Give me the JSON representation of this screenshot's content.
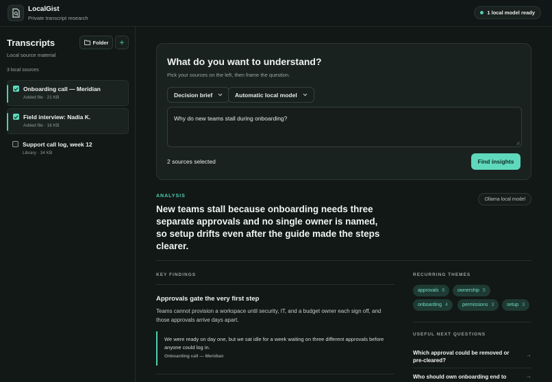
{
  "app": {
    "name": "LocalGist",
    "tagline": "Private transcript research"
  },
  "status": {
    "label": "1 local model ready",
    "color": "#4fd1b0"
  },
  "sidebar": {
    "title": "Transcripts",
    "subtitle": "Local source material",
    "folder_button": "Folder",
    "add_button": "+",
    "count": "3 local sources",
    "sources": [
      {
        "name": "Onboarding call — Meridian",
        "meta": "Added file · 21 KB",
        "checked": true
      },
      {
        "name": "Field interview: Nadia K.",
        "meta": "Added file · 16 KB",
        "checked": true
      },
      {
        "name": "Support call log, week 12",
        "meta": "Library · 34 KB",
        "checked": false
      }
    ]
  },
  "ask": {
    "title": "What do you want to understand?",
    "subtitle": "Pick your sources on the left, then frame the question.",
    "mode_select": "Decision brief",
    "model_select": "Automatic local model",
    "question": "Why do new teams stall during onboarding?",
    "selected_count": "2 sources selected",
    "submit": "Find insights"
  },
  "analysis": {
    "label": "ANALYSIS",
    "model_tag": "Ollama local model",
    "headline": "New teams stall because onboarding needs three separate approvals and no single owner is named, so setup drifts even after the guide made the steps clearer.",
    "key_findings_label": "KEY FINDINGS",
    "finding": {
      "title": "Approvals gate the very first step",
      "body": "Teams cannot provision a workspace until security, IT, and a budget owner each sign off, and those approvals arrive days apart.",
      "quote": "We were ready on day one, but we sat idle for a week waiting on three different approvals before anyone could log in.",
      "quote_source": "Onboarding call — Meridian"
    },
    "themes_label": "RECURRING THEMES",
    "themes": [
      {
        "label": "approvals",
        "count": "6"
      },
      {
        "label": "ownership",
        "count": "5"
      },
      {
        "label": "onboarding",
        "count": "4"
      },
      {
        "label": "permissions",
        "count": "3"
      },
      {
        "label": "setup",
        "count": "3"
      }
    ],
    "questions_label": "USEFUL NEXT QUESTIONS",
    "questions": [
      "Which approval could be removed or pre-cleared?",
      "Who should own onboarding end to end?"
    ],
    "accent_color": "#5fd9bb"
  }
}
